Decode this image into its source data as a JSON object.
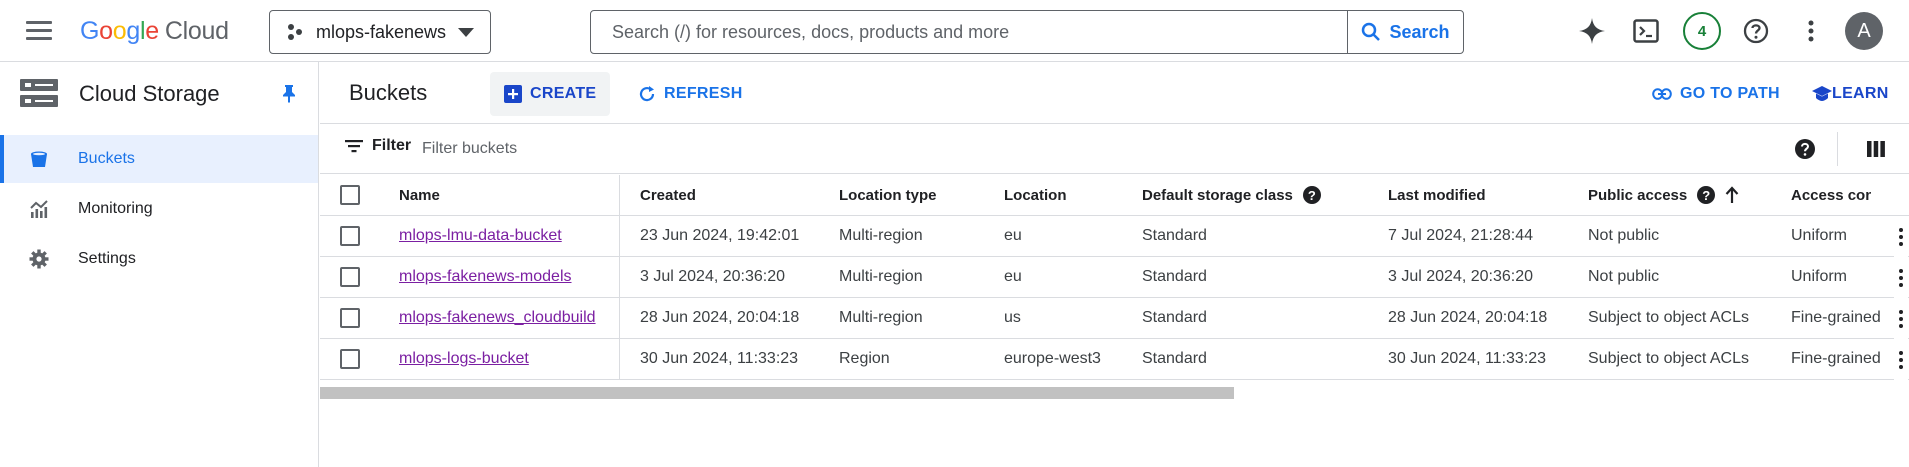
{
  "topbar": {
    "logo": {
      "letters": [
        "G",
        "o",
        "o",
        "g",
        "l",
        "e"
      ],
      "product": "Cloud"
    },
    "project": "mlops-fakenews",
    "search": {
      "placeholder": "Search (/) for resources, docs, products and more",
      "button": "Search"
    },
    "notification_count": "4",
    "avatar_initial": "A",
    "icons": [
      "menu-icon",
      "gemini-spark-icon",
      "cloud-shell-icon",
      "help-icon",
      "more-vert-icon"
    ]
  },
  "sidebar": {
    "title": "Cloud Storage",
    "items": [
      {
        "label": "Buckets",
        "icon": "bucket-icon",
        "active": true
      },
      {
        "label": "Monitoring",
        "icon": "monitoring-icon",
        "active": false
      },
      {
        "label": "Settings",
        "icon": "gear-icon",
        "active": false
      }
    ]
  },
  "main": {
    "title": "Buckets",
    "create_label": "CREATE",
    "refresh_label": "REFRESH",
    "go_to_path_label": "GO TO PATH",
    "learn_label": "LEARN",
    "filter_label": "Filter",
    "filter_placeholder": "Filter buckets"
  },
  "table": {
    "headers": {
      "name": "Name",
      "created": "Created",
      "location_type": "Location type",
      "location": "Location",
      "storage_class": "Default storage class",
      "last_modified": "Last modified",
      "public_access": "Public access",
      "access_control": "Access contr"
    },
    "rows": [
      {
        "name": "mlops-lmu-data-bucket",
        "created": "23 Jun 2024, 19:42:01",
        "location_type": "Multi-region",
        "location": "eu",
        "storage_class": "Standard",
        "last_modified": "7 Jul 2024, 21:28:44",
        "public_access": "Not public",
        "access_control": "Uniform"
      },
      {
        "name": "mlops-fakenews-models",
        "created": "3 Jul 2024, 20:36:20",
        "location_type": "Multi-region",
        "location": "eu",
        "storage_class": "Standard",
        "last_modified": "3 Jul 2024, 20:36:20",
        "public_access": "Not public",
        "access_control": "Uniform"
      },
      {
        "name": "mlops-fakenews_cloudbuild",
        "created": "28 Jun 2024, 20:04:18",
        "location_type": "Multi-region",
        "location": "us",
        "storage_class": "Standard",
        "last_modified": "28 Jun 2024, 20:04:18",
        "public_access": "Subject to object ACLs",
        "access_control": "Fine-grained"
      },
      {
        "name": "mlops-logs-bucket",
        "created": "30 Jun 2024, 11:33:23",
        "location_type": "Region",
        "location": "europe-west3",
        "storage_class": "Standard",
        "last_modified": "30 Jun 2024, 11:33:23",
        "public_access": "Subject to object ACLs",
        "access_control": "Fine-grained"
      }
    ]
  },
  "colors": {
    "accent": "#1a73e8",
    "link": "#7b1fa2",
    "active_bg": "#e8f0fe",
    "notif": "#188038"
  }
}
